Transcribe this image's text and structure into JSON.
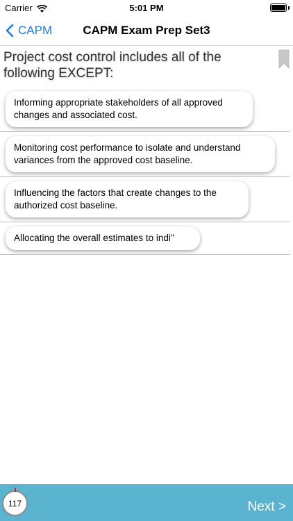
{
  "status_bar": {
    "carrier": "Carrier",
    "time": "5:01 PM"
  },
  "nav": {
    "back_label": "CAPM",
    "title": "CAPM Exam Prep Set3",
    "accent_color": "#1a7cf5"
  },
  "question": {
    "text": "Project cost control includes all of the following EXCEPT:"
  },
  "options": [
    {
      "text": "Informing appropriate stakeholders of all approved changes and associated cost."
    },
    {
      "text": "Monitoring cost performance to isolate and understand variances from the approved cost baseline."
    },
    {
      "text": "Influencing the factors that create changes to the authorized cost baseline."
    },
    {
      "text": "Allocating the overall estimates to indi\""
    }
  ],
  "footer": {
    "counter": "117",
    "next_label": "Next >",
    "bar_color": "#5ab4d0"
  },
  "icons": [
    "wifi-icon",
    "battery-icon",
    "chevron-left-icon",
    "bookmark-icon"
  ]
}
